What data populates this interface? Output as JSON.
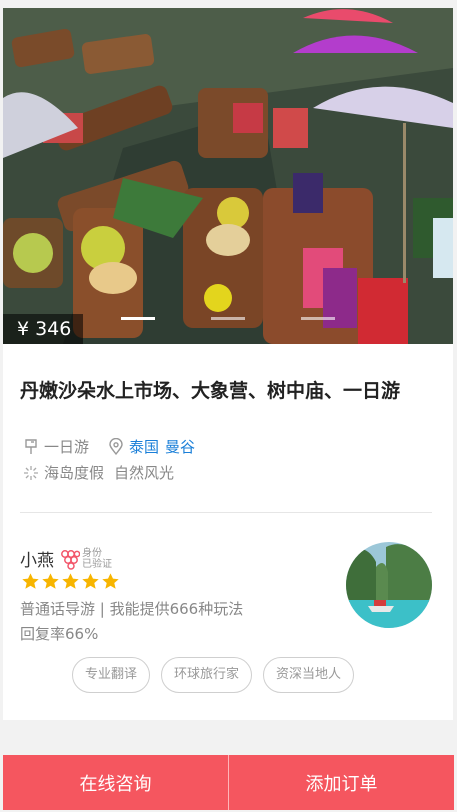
{
  "product": {
    "price_symbol": "¥",
    "price": "346",
    "title": "丹嫩沙朵水上市场、大象营、树中庙、一日游",
    "trip_type": "一日游",
    "location": [
      "泰国",
      "曼谷"
    ],
    "themes": [
      "海岛度假",
      "自然风光"
    ],
    "carousel": {
      "total_slides": 3,
      "active_slide": 1
    }
  },
  "guide": {
    "name": "小燕",
    "verify_line1": "身份",
    "verify_line2": "已验证",
    "rating": 5,
    "description": "普通话导游 | 我能提供666种玩法",
    "reply_rate": "回复率66%",
    "tags": [
      "专业翻译",
      "环球旅行家",
      "资深当地人"
    ]
  },
  "actions": {
    "consult_label": "在线咨询",
    "order_label": "添加订单"
  },
  "colors": {
    "accent": "#f5565f",
    "link": "#1a7fd8",
    "star": "#f7b500"
  },
  "icons": {
    "trip_type": "map-signpost-icon",
    "location": "location-pin-icon",
    "theme": "sparkle-icon",
    "verify": "grape-badge-icon",
    "star": "star-icon"
  }
}
